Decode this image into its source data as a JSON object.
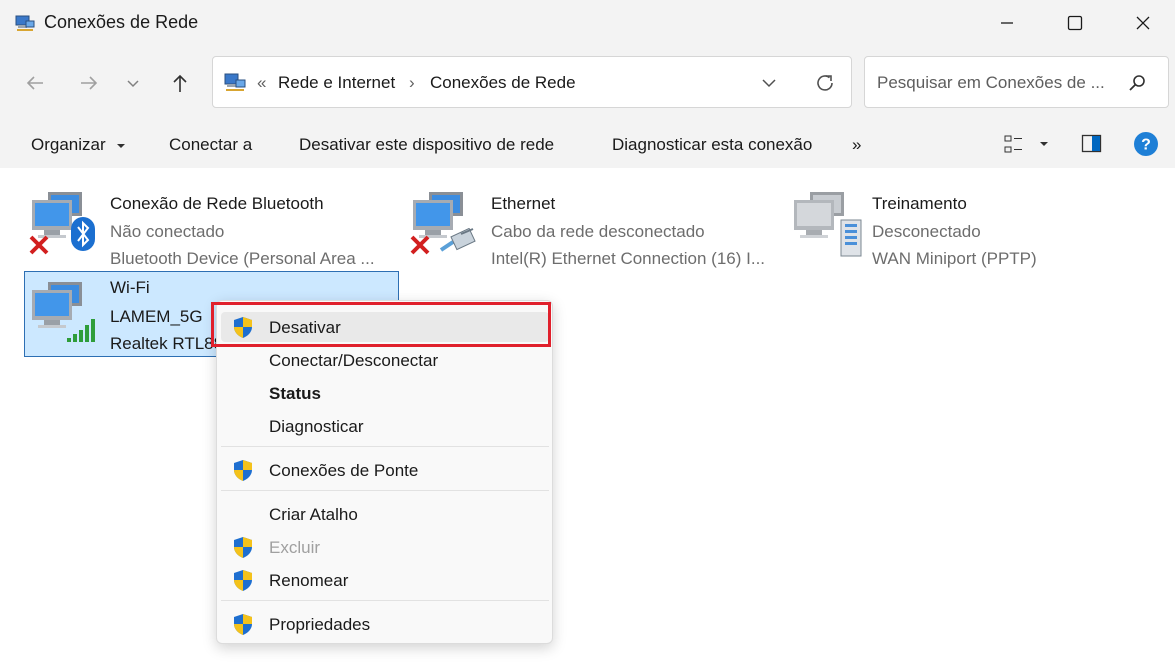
{
  "window": {
    "title": "Conexões de Rede",
    "controls": [
      "minimize-icon",
      "maximize-icon",
      "close-icon"
    ]
  },
  "nav": {
    "back_icon": "arrow-left-icon",
    "forward_icon": "arrow-right-icon",
    "recent_icon": "chevron-down-icon",
    "up_icon": "arrow-up-icon"
  },
  "address": {
    "overflow": "«",
    "crumbs": [
      "Rede e Internet",
      "Conexões de Rede"
    ],
    "separator": "›"
  },
  "search": {
    "placeholder": "Pesquisar em Conexões de ..."
  },
  "toolbar": {
    "organize": "Organizar",
    "connect": "Conectar a",
    "disable_device": "Desativar este dispositivo de rede",
    "diagnose": "Diagnosticar esta conexão",
    "more": "»"
  },
  "connections": [
    {
      "name": "Conexão de Rede Bluetooth",
      "status": "Não conectado",
      "device": "Bluetooth Device (Personal Area ...",
      "badge": "bluetooth-icon",
      "error": true
    },
    {
      "name": "Ethernet",
      "status": "Cabo da rede desconectado",
      "device": "Intel(R) Ethernet Connection (16) I...",
      "badge": "ethernet-cable-icon",
      "error": true
    },
    {
      "name": "Treinamento",
      "status": "Desconectado",
      "device": "WAN Miniport (PPTP)",
      "badge": "server-icon",
      "error": false
    },
    {
      "name": "Wi-Fi",
      "status": "LAMEM_5G",
      "device": "Realtek RTL88",
      "badge": "wifi-signal-icon",
      "error": false,
      "selected": true
    }
  ],
  "context_menu": {
    "items": [
      {
        "label": "Desativar",
        "shield": true
      },
      {
        "label": "Conectar/Desconectar",
        "shield": false
      },
      {
        "label": "Status",
        "shield": false,
        "bold": true
      },
      {
        "label": "Diagnosticar",
        "shield": false
      },
      {
        "label": "Conexões de Ponte",
        "shield": true
      },
      {
        "label": "Criar Atalho",
        "shield": false
      },
      {
        "label": "Excluir",
        "shield": true,
        "disabled": true
      },
      {
        "label": "Renomear",
        "shield": true
      },
      {
        "label": "Propriedades",
        "shield": true
      }
    ]
  },
  "colors": {
    "accent": "#0078d4",
    "highlight_box": "#e0202c",
    "selection": "#cce8ff",
    "chrome": "#f3f3f3"
  }
}
